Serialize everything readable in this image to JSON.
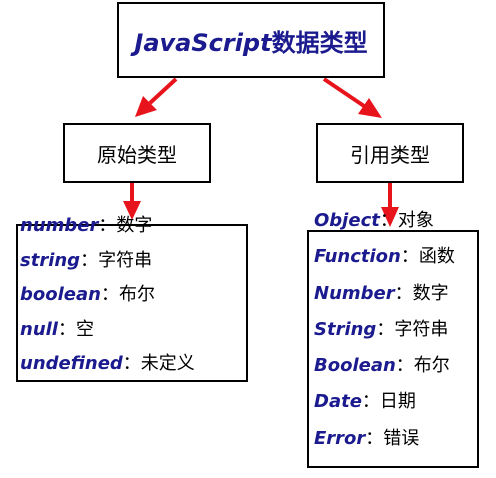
{
  "title": {
    "en": "JavaScript",
    "zh": "数据类型"
  },
  "categories": {
    "primitive": "原始类型",
    "reference": "引用类型"
  },
  "separator": "：",
  "primitive_types": [
    {
      "term": "number",
      "desc": "数字"
    },
    {
      "term": "string",
      "desc": "字符串"
    },
    {
      "term": "boolean",
      "desc": "布尔"
    },
    {
      "term": "null",
      "desc": "空"
    },
    {
      "term": "undefined",
      "desc": "未定义"
    }
  ],
  "reference_types": [
    {
      "term": "Object",
      "desc": "对象"
    },
    {
      "term": "Function",
      "desc": "函数"
    },
    {
      "term": "Number",
      "desc": "数字"
    },
    {
      "term": "String",
      "desc": "字符串"
    },
    {
      "term": "Boolean",
      "desc": "布尔"
    },
    {
      "term": "Date",
      "desc": "日期"
    },
    {
      "term": "Error",
      "desc": "错误"
    }
  ],
  "colors": {
    "term": "#1b1b8f",
    "arrow": "#e8141b",
    "border": "#000000"
  }
}
